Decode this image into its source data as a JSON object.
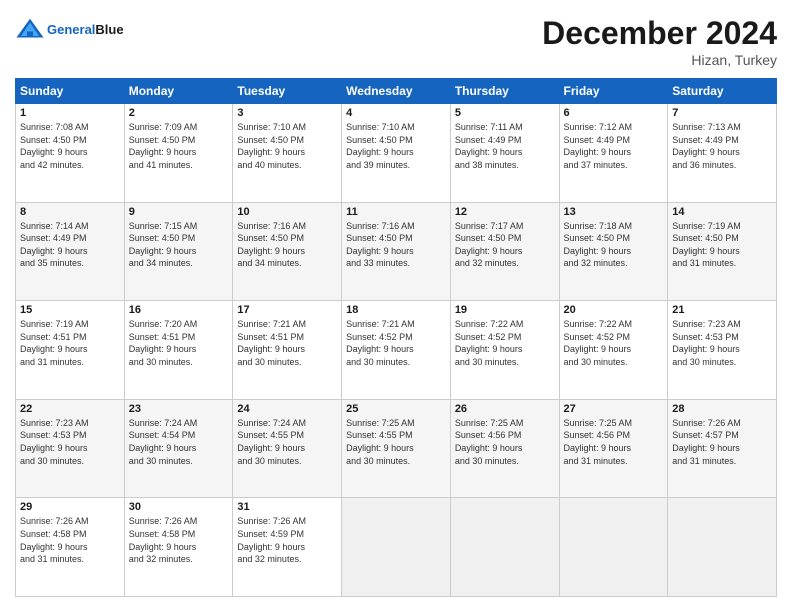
{
  "header": {
    "logo_text_general": "General",
    "logo_text_blue": "Blue",
    "month_title": "December 2024",
    "location": "Hizan, Turkey"
  },
  "calendar": {
    "headers": [
      "Sunday",
      "Monday",
      "Tuesday",
      "Wednesday",
      "Thursday",
      "Friday",
      "Saturday"
    ],
    "rows": [
      [
        {
          "day": "1",
          "info": "Sunrise: 7:08 AM\nSunset: 4:50 PM\nDaylight: 9 hours\nand 42 minutes."
        },
        {
          "day": "2",
          "info": "Sunrise: 7:09 AM\nSunset: 4:50 PM\nDaylight: 9 hours\nand 41 minutes."
        },
        {
          "day": "3",
          "info": "Sunrise: 7:10 AM\nSunset: 4:50 PM\nDaylight: 9 hours\nand 40 minutes."
        },
        {
          "day": "4",
          "info": "Sunrise: 7:10 AM\nSunset: 4:50 PM\nDaylight: 9 hours\nand 39 minutes."
        },
        {
          "day": "5",
          "info": "Sunrise: 7:11 AM\nSunset: 4:49 PM\nDaylight: 9 hours\nand 38 minutes."
        },
        {
          "day": "6",
          "info": "Sunrise: 7:12 AM\nSunset: 4:49 PM\nDaylight: 9 hours\nand 37 minutes."
        },
        {
          "day": "7",
          "info": "Sunrise: 7:13 AM\nSunset: 4:49 PM\nDaylight: 9 hours\nand 36 minutes."
        }
      ],
      [
        {
          "day": "8",
          "info": "Sunrise: 7:14 AM\nSunset: 4:49 PM\nDaylight: 9 hours\nand 35 minutes."
        },
        {
          "day": "9",
          "info": "Sunrise: 7:15 AM\nSunset: 4:50 PM\nDaylight: 9 hours\nand 34 minutes."
        },
        {
          "day": "10",
          "info": "Sunrise: 7:16 AM\nSunset: 4:50 PM\nDaylight: 9 hours\nand 34 minutes."
        },
        {
          "day": "11",
          "info": "Sunrise: 7:16 AM\nSunset: 4:50 PM\nDaylight: 9 hours\nand 33 minutes."
        },
        {
          "day": "12",
          "info": "Sunrise: 7:17 AM\nSunset: 4:50 PM\nDaylight: 9 hours\nand 32 minutes."
        },
        {
          "day": "13",
          "info": "Sunrise: 7:18 AM\nSunset: 4:50 PM\nDaylight: 9 hours\nand 32 minutes."
        },
        {
          "day": "14",
          "info": "Sunrise: 7:19 AM\nSunset: 4:50 PM\nDaylight: 9 hours\nand 31 minutes."
        }
      ],
      [
        {
          "day": "15",
          "info": "Sunrise: 7:19 AM\nSunset: 4:51 PM\nDaylight: 9 hours\nand 31 minutes."
        },
        {
          "day": "16",
          "info": "Sunrise: 7:20 AM\nSunset: 4:51 PM\nDaylight: 9 hours\nand 30 minutes."
        },
        {
          "day": "17",
          "info": "Sunrise: 7:21 AM\nSunset: 4:51 PM\nDaylight: 9 hours\nand 30 minutes."
        },
        {
          "day": "18",
          "info": "Sunrise: 7:21 AM\nSunset: 4:52 PM\nDaylight: 9 hours\nand 30 minutes."
        },
        {
          "day": "19",
          "info": "Sunrise: 7:22 AM\nSunset: 4:52 PM\nDaylight: 9 hours\nand 30 minutes."
        },
        {
          "day": "20",
          "info": "Sunrise: 7:22 AM\nSunset: 4:52 PM\nDaylight: 9 hours\nand 30 minutes."
        },
        {
          "day": "21",
          "info": "Sunrise: 7:23 AM\nSunset: 4:53 PM\nDaylight: 9 hours\nand 30 minutes."
        }
      ],
      [
        {
          "day": "22",
          "info": "Sunrise: 7:23 AM\nSunset: 4:53 PM\nDaylight: 9 hours\nand 30 minutes."
        },
        {
          "day": "23",
          "info": "Sunrise: 7:24 AM\nSunset: 4:54 PM\nDaylight: 9 hours\nand 30 minutes."
        },
        {
          "day": "24",
          "info": "Sunrise: 7:24 AM\nSunset: 4:55 PM\nDaylight: 9 hours\nand 30 minutes."
        },
        {
          "day": "25",
          "info": "Sunrise: 7:25 AM\nSunset: 4:55 PM\nDaylight: 9 hours\nand 30 minutes."
        },
        {
          "day": "26",
          "info": "Sunrise: 7:25 AM\nSunset: 4:56 PM\nDaylight: 9 hours\nand 30 minutes."
        },
        {
          "day": "27",
          "info": "Sunrise: 7:25 AM\nSunset: 4:56 PM\nDaylight: 9 hours\nand 31 minutes."
        },
        {
          "day": "28",
          "info": "Sunrise: 7:26 AM\nSunset: 4:57 PM\nDaylight: 9 hours\nand 31 minutes."
        }
      ],
      [
        {
          "day": "29",
          "info": "Sunrise: 7:26 AM\nSunset: 4:58 PM\nDaylight: 9 hours\nand 31 minutes."
        },
        {
          "day": "30",
          "info": "Sunrise: 7:26 AM\nSunset: 4:58 PM\nDaylight: 9 hours\nand 32 minutes."
        },
        {
          "day": "31",
          "info": "Sunrise: 7:26 AM\nSunset: 4:59 PM\nDaylight: 9 hours\nand 32 minutes."
        },
        {
          "day": "",
          "info": ""
        },
        {
          "day": "",
          "info": ""
        },
        {
          "day": "",
          "info": ""
        },
        {
          "day": "",
          "info": ""
        }
      ]
    ]
  }
}
